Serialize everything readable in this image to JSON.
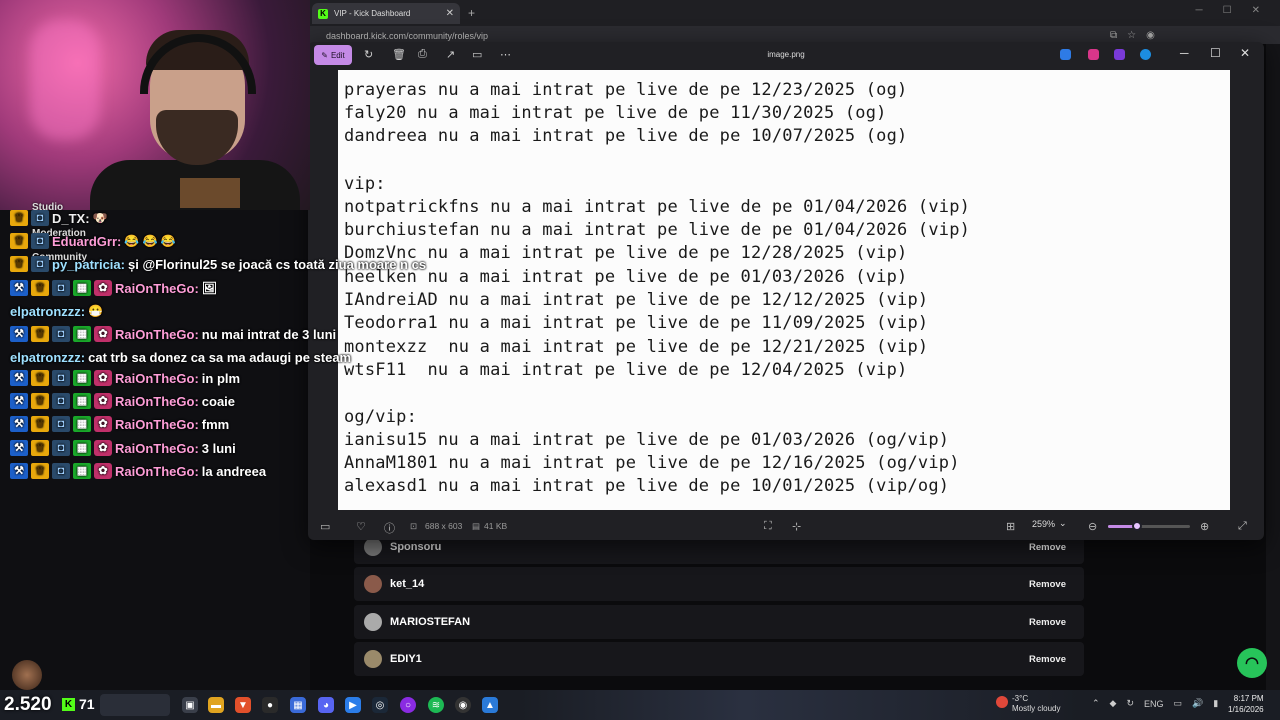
{
  "browser": {
    "tab_title": "VIP - Kick Dashboard",
    "tab_favicon": "K",
    "url": "dashboard.kick.com/community/roles/vip"
  },
  "viewer": {
    "title": "image.png",
    "edit_label": "Edit",
    "dimensions": "688 x 603",
    "filesize": "41 KB",
    "zoom": "259%",
    "zoom_fraction": 0.35,
    "image_lines": [
      "prayeras nu a mai intrat pe live de pe 12/23/2025 (og)",
      "faly20 nu a mai intrat pe live de pe 11/30/2025 (og)",
      "dandreea nu a mai intrat pe live de pe 10/07/2025 (og)",
      "",
      "vip:",
      "notpatrickfns nu a mai intrat pe live de pe 01/04/2026 (vip)",
      "burchiustefan nu a mai intrat pe live de pe 01/04/2026 (vip)",
      "DomzVnc nu a mai intrat pe live de pe 12/28/2025 (vip)",
      "heelken nu a mai intrat pe live de pe 01/03/2026 (vip)",
      "IAndreiAD nu a mai intrat pe live de pe 12/12/2025 (vip)",
      "Teodorra1 nu a mai intrat pe live de pe 11/09/2025 (vip)",
      "montexzz  nu a mai intrat pe live de pe 12/21/2025 (vip)",
      "wtsF11  nu a mai intrat pe live de pe 12/04/2025 (vip)",
      "",
      "og/vip:",
      "ianisu15 nu a mai intrat pe live de pe 01/03/2026 (og/vip)",
      "AnnaM1801 nu a mai intrat pe live de pe 12/16/2025 (og/vip)",
      "alexasd1 nu a mai intrat pe live de pe 10/01/2025 (vip/og)"
    ]
  },
  "vip_list": [
    {
      "name": "Sponsoru",
      "action": "Remove"
    },
    {
      "name": "ket_14",
      "action": "Remove"
    },
    {
      "name": "MARIOSTEFAN",
      "action": "Remove"
    },
    {
      "name": "EDIY1",
      "action": "Remove"
    }
  ],
  "chat": {
    "overlay_labels": [
      "Studio",
      "Moderation",
      "Community"
    ],
    "messages": [
      {
        "user": "D_TX:",
        "text": "",
        "emotes": "🐶"
      },
      {
        "user": "EduardGrr:",
        "text": "",
        "emotes": "😂 😂 😂"
      },
      {
        "user": "py_patricia:",
        "text": "și @Florinul25 se joacă cs toată ziua moare n cs",
        "emotes": ""
      },
      {
        "user": "RaiOnTheGo:",
        "text": "",
        "emotes": "🖼"
      },
      {
        "user": "elpatronzzz:",
        "text": "",
        "emotes": "😷"
      },
      {
        "user": "RaiOnTheGo:",
        "text": "nu mai intrat de 3 luni",
        "emotes": ""
      },
      {
        "user": "elpatronzzz:",
        "text": "cat trb sa donez ca sa ma adaugi pe steam",
        "emotes": ""
      },
      {
        "user": "RaiOnTheGo:",
        "text": "in plm",
        "emotes": ""
      },
      {
        "user": "RaiOnTheGo:",
        "text": "coaie",
        "emotes": ""
      },
      {
        "user": "RaiOnTheGo:",
        "text": "fmm",
        "emotes": ""
      },
      {
        "user": "RaiOnTheGo:",
        "text": "3 luni",
        "emotes": ""
      },
      {
        "user": "RaiOnTheGo:",
        "text": "la andreea",
        "emotes": ""
      }
    ]
  },
  "stream_stats": {
    "viewers": "2.520",
    "followers": "71"
  },
  "taskbar": {
    "weather_temp": "-3°C",
    "weather_desc": "Mostly cloudy",
    "language": "ENG",
    "time": "8:17 PM",
    "date": "1/16/2026"
  },
  "colors": {
    "kick_green": "#53fc18",
    "viewer_accent": "#c48ae6",
    "support_green": "#27c45a"
  }
}
